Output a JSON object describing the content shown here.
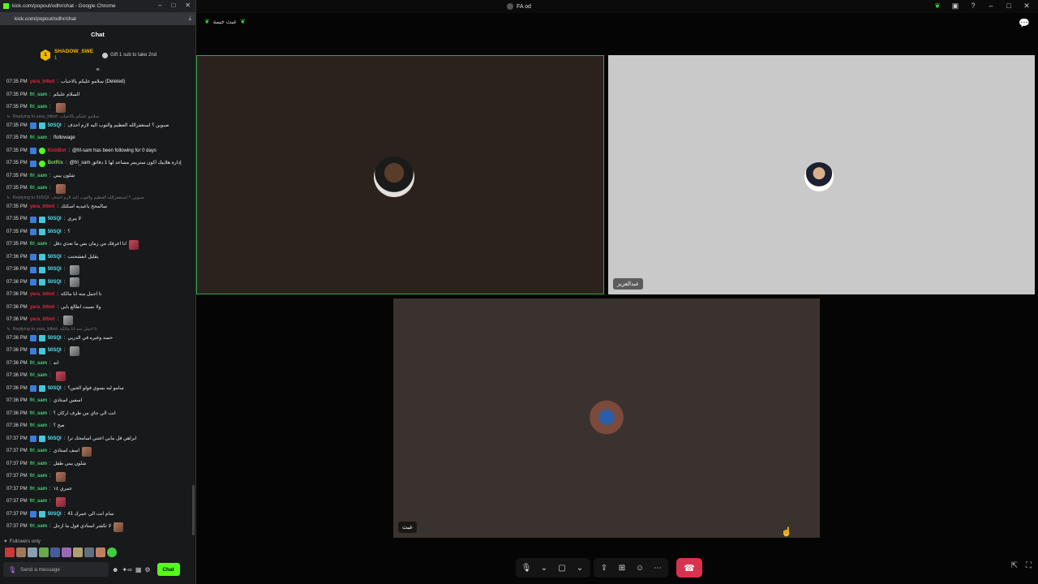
{
  "meet": {
    "title": "FA od",
    "header_name": "عبث خيمة",
    "tiles": [
      {
        "name": ""
      },
      {
        "name": "عبدالعزيز"
      },
      {
        "name": "عبث"
      }
    ],
    "controls": {
      "mic": "🎙",
      "cam": "▢",
      "present": "⇪",
      "apps": "⊞",
      "react": "☺",
      "more": "⋯",
      "end": "☎"
    }
  },
  "chrome": {
    "title": "kick.com/popout/odhr/chat - Google Chrome",
    "url": "kick.com/popout/odhr/chat"
  },
  "chat": {
    "header": "Chat",
    "gift": {
      "user": "SHADOW_SWE",
      "count": "1",
      "text": "Gift 1 sub to take 2nd"
    },
    "followers_only": "Followers only",
    "input_placeholder": "Send a message",
    "send_label": "Chat",
    "messages": [
      {
        "type": "msg",
        "ts": "07:35 PM",
        "user": "yara_btbot",
        "color": "red",
        "badges": [],
        "text": "سلامو عليكم يالاحباب (Deleted)",
        "emote": ""
      },
      {
        "type": "msg",
        "ts": "07:35 PM",
        "user": "frl_sam",
        "color": "green",
        "badges": [],
        "text": "السلام عليكم",
        "emote": ""
      },
      {
        "type": "msg",
        "ts": "07:35 PM",
        "user": "frl_sam",
        "color": "green",
        "badges": [],
        "text": "",
        "emote": "brown"
      },
      {
        "type": "reply",
        "text": "Replying to yara_btbot: سلامو عليكم يالاحباب"
      },
      {
        "type": "msg",
        "ts": "07:35 PM",
        "user": "50SQI",
        "color": "teal",
        "badges": [
          "blue",
          "teal"
        ],
        "text": "صبوين ؟ استغفرالله العظيم والتوب اليه لازم احذف",
        "emote": ""
      },
      {
        "type": "msg",
        "ts": "07:35 PM",
        "user": "frl_sam",
        "color": "green",
        "badges": [],
        "text": "!followage",
        "emote": ""
      },
      {
        "type": "msg",
        "ts": "07:35 PM",
        "user": "KickBot",
        "color": "red",
        "badges": [
          "blue",
          "greenround"
        ],
        "text": "@frl-sam has been following for 0 days",
        "emote": ""
      },
      {
        "type": "msg",
        "ts": "07:35 PM",
        "user": "BotRix",
        "color": "lime",
        "badges": [
          "blue",
          "greenround"
        ],
        "text": "@frl_sam إدارة هلابيك اكون ستريمر مساعد لها 1 دقائق",
        "emote": ""
      },
      {
        "type": "msg",
        "ts": "07:35 PM",
        "user": "frl_sam",
        "color": "green",
        "badges": [],
        "text": "شلون يبني",
        "emote": ""
      },
      {
        "type": "msg",
        "ts": "07:35 PM",
        "user": "frl_sam",
        "color": "green",
        "badges": [],
        "text": "",
        "emote": "brown"
      },
      {
        "type": "reply",
        "text": "Replying to 50SQI: صبوين ؟ استغفرالله العظيم والتوب اليه لازم احذف"
      },
      {
        "type": "msg",
        "ts": "07:35 PM",
        "user": "yara_btbot",
        "color": "red",
        "badges": [],
        "text": "سالمحح ياعيديه اسكتك",
        "emote": ""
      },
      {
        "type": "msg",
        "ts": "07:35 PM",
        "user": "50SQI",
        "color": "teal",
        "badges": [
          "blue",
          "teal"
        ],
        "text": "لا يبري",
        "emote": ""
      },
      {
        "type": "msg",
        "ts": "07:35 PM",
        "user": "50SQI",
        "color": "teal",
        "badges": [
          "blue",
          "teal"
        ],
        "text": "؟",
        "emote": ""
      },
      {
        "type": "msg",
        "ts": "07:35 PM",
        "user": "frl_sam",
        "color": "green",
        "badges": [],
        "text": "انا اعرفك من زمان بس ما تعذي دقل",
        "emote": "red"
      },
      {
        "type": "msg",
        "ts": "07:36 PM",
        "user": "50SQI",
        "color": "teal",
        "badges": [
          "blue",
          "teal"
        ],
        "text": "يقليل انفشحنت",
        "emote": ""
      },
      {
        "type": "msg",
        "ts": "07:36 PM",
        "user": "50SQI",
        "color": "teal",
        "badges": [
          "blue",
          "teal"
        ],
        "text": "",
        "emote": "gray"
      },
      {
        "type": "msg",
        "ts": "07:36 PM",
        "user": "50SQI",
        "color": "teal",
        "badges": [
          "blue",
          "teal"
        ],
        "text": "",
        "emote": "gray"
      },
      {
        "type": "msg",
        "ts": "07:36 PM",
        "user": "yara_btbot",
        "color": "red",
        "badges": [],
        "text": "نا اجمل منه انا مالكه",
        "emote": ""
      },
      {
        "type": "msg",
        "ts": "07:36 PM",
        "user": "yara_btbot",
        "color": "red",
        "badges": [],
        "text": "ولا نسيت اطالع بابي",
        "emote": ""
      },
      {
        "type": "msg",
        "ts": "07:36 PM",
        "user": "yara_btbot",
        "color": "red",
        "badges": [],
        "text": "",
        "emote": "gray"
      },
      {
        "type": "reply",
        "text": "Replying to yara_btbot: نا اجمل منه انا مالكه"
      },
      {
        "type": "msg",
        "ts": "07:36 PM",
        "user": "50SQI",
        "color": "teal",
        "badges": [
          "blue",
          "teal"
        ],
        "text": "حسد وغيره في الدربي",
        "emote": ""
      },
      {
        "type": "msg",
        "ts": "07:36 PM",
        "user": "50SQI",
        "color": "teal",
        "badges": [
          "blue",
          "teal"
        ],
        "text": "",
        "emote": "gray"
      },
      {
        "type": "msg",
        "ts": "07:36 PM",
        "user": "frl_sam",
        "color": "green",
        "badges": [],
        "text": "انه",
        "emote": ""
      },
      {
        "type": "msg",
        "ts": "07:36 PM",
        "user": "frl_sam",
        "color": "green",
        "badges": [],
        "text": "",
        "emote": "red"
      },
      {
        "type": "msg",
        "ts": "07:36 PM",
        "user": "50SQI",
        "color": "teal",
        "badges": [
          "blue",
          "teal"
        ],
        "text": "سامو ليه يسوي فولو الحين؟",
        "emote": ""
      },
      {
        "type": "msg",
        "ts": "07:36 PM",
        "user": "frl_sam",
        "color": "green",
        "badges": [],
        "text": "اسفين استاذي",
        "emote": ""
      },
      {
        "type": "msg",
        "ts": "07:36 PM",
        "user": "frl_sam",
        "color": "green",
        "badges": [],
        "text": "انت الي جاي من طرف اركان ؟",
        "emote": ""
      },
      {
        "type": "msg",
        "ts": "07:36 PM",
        "user": "frl_sam",
        "color": "green",
        "badges": [],
        "text": "صح ؟",
        "emote": ""
      },
      {
        "type": "msg",
        "ts": "07:37 PM",
        "user": "50SQI",
        "color": "teal",
        "badges": [
          "blue",
          "teal"
        ],
        "text": "ابراهي قل مابي اعتني اسامحك ترا",
        "emote": ""
      },
      {
        "type": "msg",
        "ts": "07:37 PM",
        "user": "frl_sam",
        "color": "green",
        "badges": [],
        "text": "اسف استاذي",
        "emote": "brown"
      },
      {
        "type": "msg",
        "ts": "07:37 PM",
        "user": "frl_sam",
        "color": "green",
        "badges": [],
        "text": "شلون يبني طفل",
        "emote": ""
      },
      {
        "type": "msg",
        "ts": "07:37 PM",
        "user": "frl_sam",
        "color": "green",
        "badges": [],
        "text": "",
        "emote": "brown"
      },
      {
        "type": "msg",
        "ts": "07:37 PM",
        "user": "frl_sam",
        "color": "green",
        "badges": [],
        "text": "عمري ١٤",
        "emote": ""
      },
      {
        "type": "msg",
        "ts": "07:37 PM",
        "user": "frl_sam",
        "color": "green",
        "badges": [],
        "text": "",
        "emote": "red"
      },
      {
        "type": "msg",
        "ts": "07:37 PM",
        "user": "50SQI",
        "color": "teal",
        "badges": [
          "blue",
          "teal"
        ],
        "text": "سام انت الي عمرك 41",
        "emote": ""
      },
      {
        "type": "msg",
        "ts": "07:37 PM",
        "user": "frl_sam",
        "color": "green",
        "badges": [],
        "text": "لا تكشر استاذي قول ما ارجل",
        "emote": "brown"
      }
    ]
  }
}
